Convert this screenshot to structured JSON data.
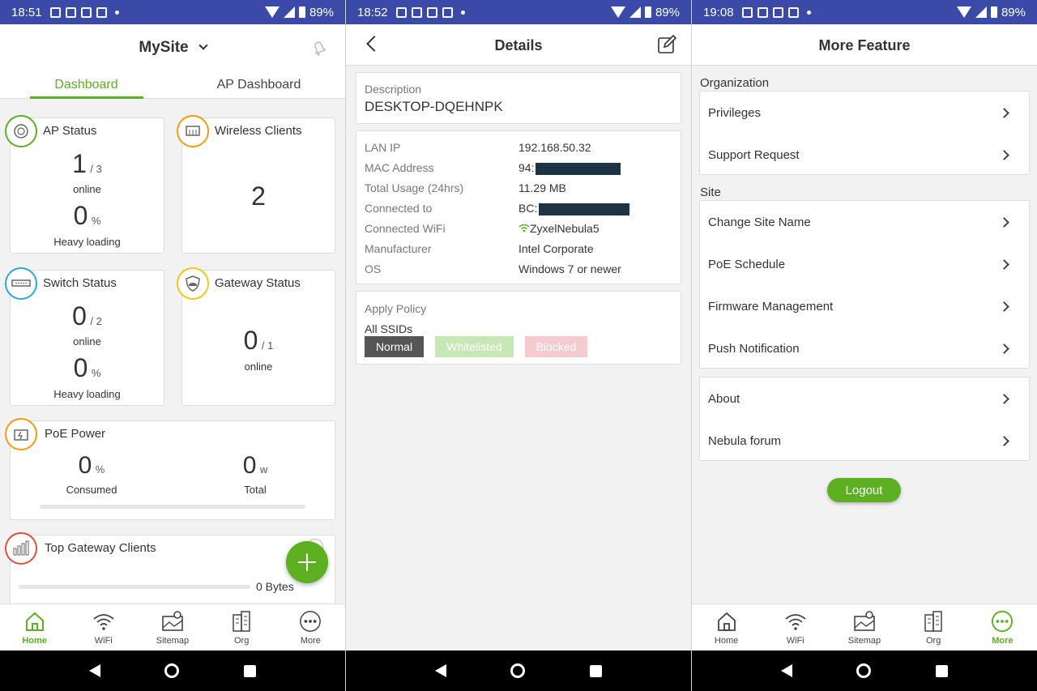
{
  "status_bars": [
    {
      "time": "18:51",
      "battery": "89%"
    },
    {
      "time": "18:52",
      "battery": "89%"
    },
    {
      "time": "19:08",
      "battery": "89%"
    }
  ],
  "dashboard": {
    "site_name": "MySite",
    "tabs": [
      "Dashboard",
      "AP Dashboard"
    ],
    "ap_status": {
      "title": "AP Status",
      "online": "1",
      "total": "/ 3",
      "online_label": "online",
      "load": "0",
      "load_unit": "%",
      "load_label": "Heavy loading"
    },
    "wireless_clients": {
      "title": "Wireless Clients",
      "count": "2"
    },
    "switch_status": {
      "title": "Switch Status",
      "online": "0",
      "total": "/ 2",
      "online_label": "online",
      "load": "0",
      "load_unit": "%",
      "load_label": "Heavy loading"
    },
    "gateway_status": {
      "title": "Gateway Status",
      "online": "0",
      "total": "/ 1",
      "online_label": "online"
    },
    "poe_power": {
      "title": "PoE Power",
      "consumed": "0",
      "consumed_unit": "%",
      "consumed_label": "Consumed",
      "total": "0",
      "total_unit": "w",
      "total_label": "Total"
    },
    "top_gateway_clients": {
      "title": "Top Gateway Clients",
      "bytes": "0 Bytes"
    }
  },
  "bottom_tabs": [
    "Home",
    "WiFi",
    "Sitemap",
    "Org",
    "More"
  ],
  "details": {
    "title": "Details",
    "description_label": "Description",
    "description_value": "DESKTOP-DQEHNPK",
    "rows": [
      {
        "label": "LAN IP",
        "value": "192.168.50.32"
      },
      {
        "label": "MAC Address",
        "value": "94:"
      },
      {
        "label": "Total Usage (24hrs)",
        "value": "11.29 MB"
      },
      {
        "label": "Connected to",
        "value": "BC:"
      },
      {
        "label": "Connected WiFi",
        "value": "ZyxelNebula5"
      },
      {
        "label": "Manufacturer",
        "value": "Intel Corporate"
      },
      {
        "label": "OS",
        "value": "Windows 7 or newer"
      }
    ],
    "policy_label": "Apply Policy",
    "ssids_label": "All SSIDs",
    "policy_options": [
      "Normal",
      "Whitelisted",
      "Blocked"
    ]
  },
  "more": {
    "title": "More Feature",
    "organization_label": "Organization",
    "organization_items": [
      "Privileges",
      "Support Request"
    ],
    "site_label": "Site",
    "site_items": [
      "Change Site Name",
      "PoE Schedule",
      "Firmware Management",
      "Push Notification"
    ],
    "other_items": [
      "About",
      "Nebula forum"
    ],
    "logout": "Logout"
  },
  "colors": {
    "accent": "#5cb021",
    "statusbar": "#3b4aa7"
  }
}
